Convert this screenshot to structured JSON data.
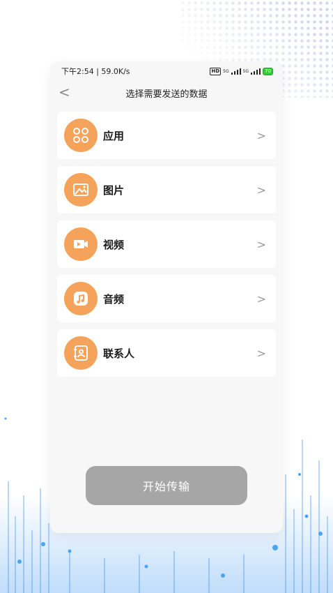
{
  "status_bar": {
    "time_speed": "下午2:54 | 59.0K/s",
    "hd": "HD",
    "network1": "5G",
    "network2": "5G",
    "battery": "70"
  },
  "header": {
    "back_icon": "chevron-left-icon",
    "title": "选择需要发送的数据"
  },
  "items": [
    {
      "label": "应用",
      "icon": "apps-icon"
    },
    {
      "label": "图片",
      "icon": "image-icon"
    },
    {
      "label": "视频",
      "icon": "video-icon"
    },
    {
      "label": "音频",
      "icon": "music-icon"
    },
    {
      "label": "联系人",
      "icon": "contact-icon"
    }
  ],
  "start_button": {
    "label": "开始传输"
  },
  "colors": {
    "accent": "#f5a35b",
    "button_disabled": "#a6a6a6",
    "background": "#f7f7f7"
  }
}
